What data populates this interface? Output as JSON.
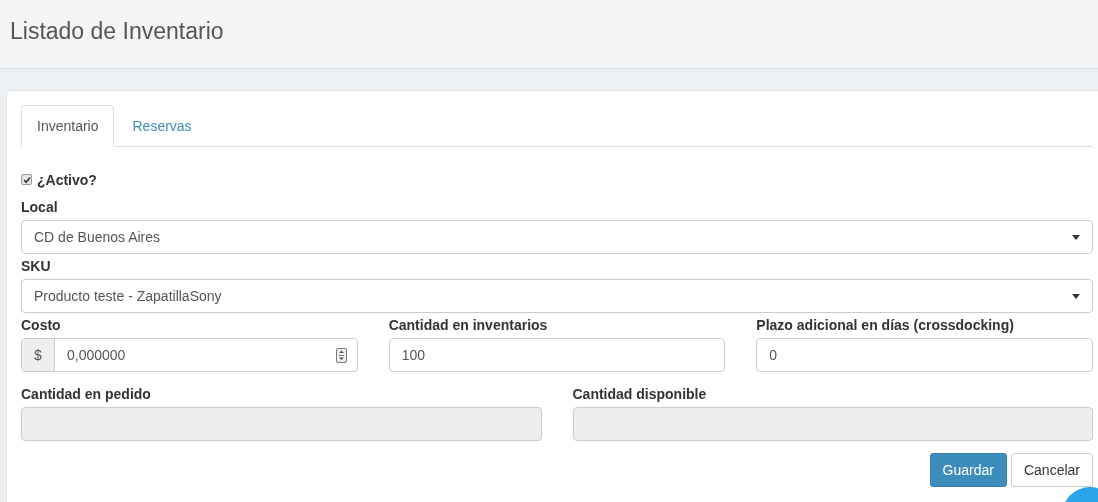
{
  "header": {
    "title": "Listado de Inventario"
  },
  "tabs": [
    {
      "label": "Inventario",
      "selected": true
    },
    {
      "label": "Reservas",
      "selected": false
    }
  ],
  "active": {
    "label": "¿Activo?",
    "checked": true
  },
  "rows": [
    [
      {
        "kind": "select",
        "label": "Local",
        "value": "CD de Buenos Aires"
      }
    ],
    [
      {
        "kind": "select",
        "label": "SKU",
        "value": "Producto teste - ZapatillaSony"
      }
    ],
    [
      {
        "kind": "currency",
        "label": "Costo",
        "prefix": "$",
        "value": "0,000000"
      },
      {
        "kind": "text",
        "label": "Cantidad en inventarios",
        "value": "100"
      },
      {
        "kind": "text",
        "label": "Plazo adicional en días (crossdocking)",
        "value": "0"
      }
    ],
    [
      {
        "kind": "text",
        "label": "Cantidad en pedido",
        "disabled": true
      },
      {
        "kind": "text",
        "label": "Cantidad disponible",
        "disabled": true
      }
    ]
  ],
  "buttons": [
    {
      "label": "Guardar",
      "kind": "primary"
    },
    {
      "label": "Cancelar",
      "kind": "default"
    }
  ]
}
